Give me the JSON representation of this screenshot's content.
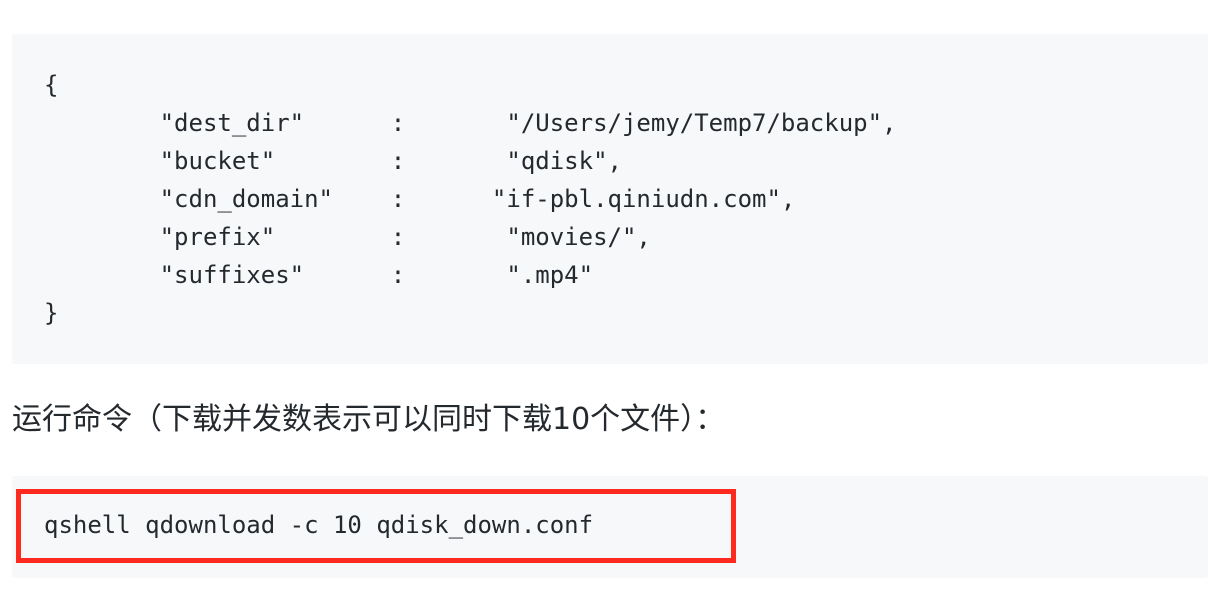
{
  "config_block": {
    "lines": [
      "{",
      "        \"dest_dir\"      :       \"/Users/jemy/Temp7/backup\",",
      "        \"bucket\"        :       \"qdisk\",",
      "        \"cdn_domain\"    :      \"if-pbl.qiniudn.com\",",
      "        \"prefix\"        :       \"movies/\",",
      "        \"suffixes\"      :       \".mp4\"",
      "}"
    ]
  },
  "prose": {
    "run_command_label": "运行命令（下载并发数表示可以同时下载10个文件）："
  },
  "command_block": {
    "command": "qshell qdownload -c 10 qdisk_down.conf"
  },
  "colors": {
    "code_background": "#f6f8fa",
    "text": "#24292e",
    "highlight_border": "#ff2a1f"
  }
}
